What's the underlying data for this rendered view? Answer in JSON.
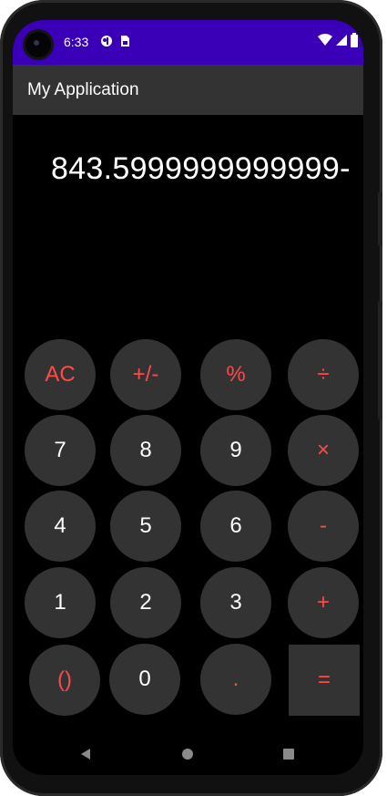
{
  "status_bar": {
    "time": "6:33",
    "background": "#3a00b8"
  },
  "app_bar": {
    "title": "My Application",
    "background": "#333333"
  },
  "display": {
    "expression": "843.5999999999999-"
  },
  "keys": {
    "ac": "AC",
    "sign": "+/-",
    "percent": "%",
    "divide": "÷",
    "seven": "7",
    "eight": "8",
    "nine": "9",
    "multiply": "×",
    "four": "4",
    "five": "5",
    "six": "6",
    "minus": "-",
    "one": "1",
    "two": "2",
    "three": "3",
    "plus": "+",
    "parens": "()",
    "zero": "0",
    "dot": ".",
    "equals": "="
  },
  "colors": {
    "operator": "#ff4a4a",
    "key_background": "#333333",
    "screen_background": "#000000"
  },
  "icons": {
    "status": [
      "notification-icon",
      "sim-icon",
      "wifi-icon",
      "signal-icon",
      "battery-icon"
    ],
    "nav": [
      "back-icon",
      "home-icon",
      "recents-icon"
    ]
  }
}
